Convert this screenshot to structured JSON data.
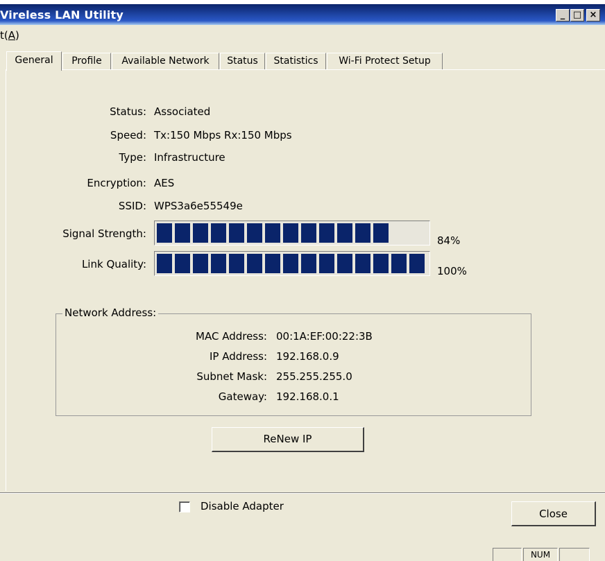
{
  "window": {
    "title": "Vireless LAN Utility",
    "minimize": "_",
    "maximize": "□",
    "close": "×"
  },
  "menu": {
    "item_prefix": "t(",
    "item_hotkey": "A",
    "item_suffix": ")"
  },
  "tabs": [
    {
      "label": "General",
      "active": true
    },
    {
      "label": "Profile",
      "active": false
    },
    {
      "label": "Available Network",
      "active": false
    },
    {
      "label": "Status",
      "active": false
    },
    {
      "label": "Statistics",
      "active": false
    },
    {
      "label": "Wi-Fi Protect Setup",
      "active": false
    }
  ],
  "general": {
    "status_label": "Status:",
    "status_value": "Associated",
    "speed_label": "Speed:",
    "speed_value": "Tx:150 Mbps Rx:150 Mbps",
    "type_label": "Type:",
    "type_value": "Infrastructure",
    "encryption_label": "Encryption:",
    "encryption_value": "AES",
    "ssid_label": "SSID:",
    "ssid_value": "WPS3a6e55549e",
    "signal_label": "Signal Strength:",
    "signal_percent_text": "84%",
    "signal_fraction": 0.84,
    "link_label": "Link Quality:",
    "link_percent_text": "100%",
    "link_fraction": 1.0
  },
  "network_address": {
    "title": "Network Address:",
    "mac_label": "MAC Address:",
    "mac_value": "00:1A:EF:00:22:3B",
    "ip_label": "IP Address:",
    "ip_value": "192.168.0.9",
    "subnet_label": "Subnet Mask:",
    "subnet_value": "255.255.255.0",
    "gateway_label": "Gateway:",
    "gateway_value": "192.168.0.1"
  },
  "renew_button": "ReNew IP",
  "disable_adapter": {
    "label": "Disable Adapter",
    "checked": false
  },
  "close_button": "Close",
  "statusbar": {
    "num": "NUM"
  },
  "colors": {
    "bar_fill": "#0a246a",
    "title_gradient_dark": "#0a246a",
    "face": "#ece9d8"
  }
}
